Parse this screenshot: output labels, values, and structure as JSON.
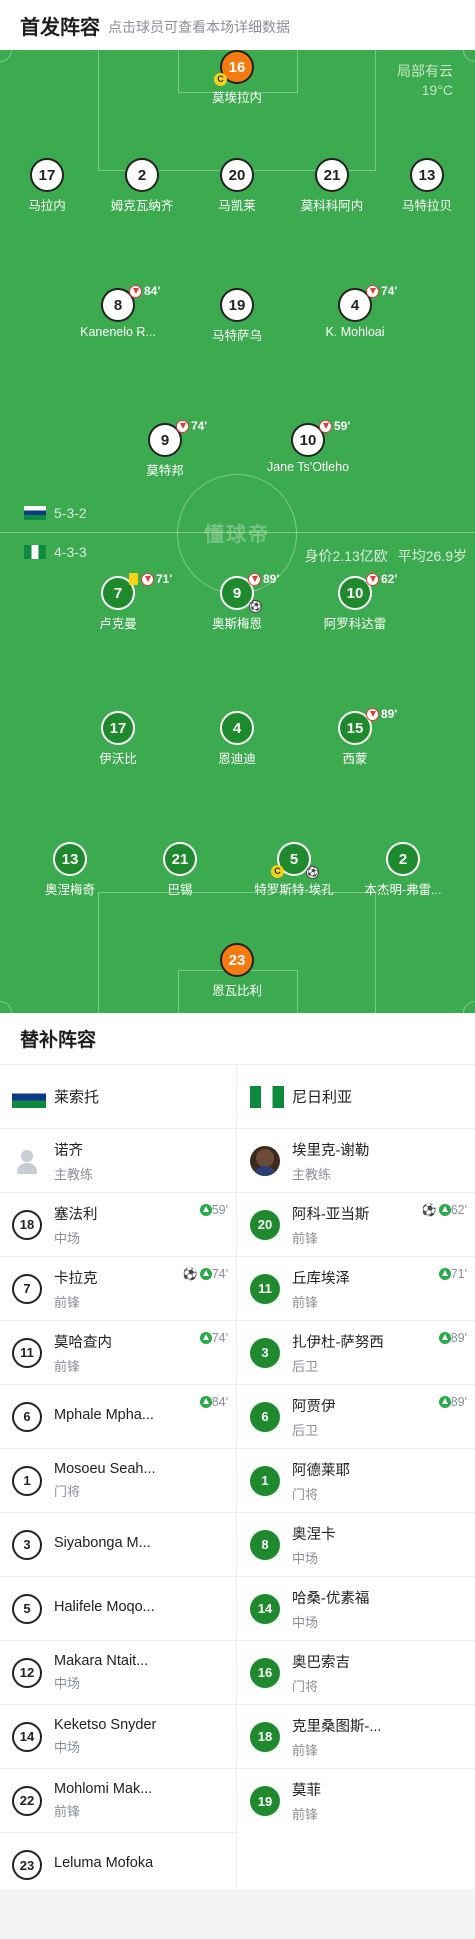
{
  "header": {
    "title": "首发阵容",
    "subtitle": "点击球员可查看本场详细数据"
  },
  "weather": {
    "condition": "局部有云",
    "temp": "19°C"
  },
  "home": {
    "name": "莱索托",
    "formation": "5-3-2",
    "goalkeeper": {
      "num": "16",
      "name": "莫埃拉内",
      "captain": "C"
    },
    "defenders": [
      {
        "num": "17",
        "name": "马拉内"
      },
      {
        "num": "2",
        "name": "姆克瓦纳齐"
      },
      {
        "num": "20",
        "name": "马凯莱"
      },
      {
        "num": "21",
        "name": "莫科科阿内"
      },
      {
        "num": "13",
        "name": "马特拉贝"
      }
    ],
    "midfielders": [
      {
        "num": "8",
        "name": "Kanenelo R...",
        "sub": "84'"
      },
      {
        "num": "19",
        "name": "马特萨乌"
      },
      {
        "num": "4",
        "name": "K. Mohloai",
        "sub": "74'"
      }
    ],
    "forwards": [
      {
        "num": "9",
        "name": "莫特邦",
        "sub": "74'"
      },
      {
        "num": "10",
        "name": "Jane Ts'Otleho",
        "sub": "59'"
      }
    ]
  },
  "away": {
    "name": "尼日利亚",
    "formation": "4-3-3",
    "value_label": "身价2.13亿欧",
    "age_label": "平均26.9岁",
    "forwards": [
      {
        "num": "7",
        "name": "卢克曼",
        "sub": "71'"
      },
      {
        "num": "9",
        "name": "奥斯梅恩",
        "sub": "89'"
      },
      {
        "num": "10",
        "name": "阿罗科达雷",
        "sub": "62'"
      }
    ],
    "midfielders": [
      {
        "num": "17",
        "name": "伊沃比"
      },
      {
        "num": "4",
        "name": "恩迪迪"
      },
      {
        "num": "15",
        "name": "西蒙",
        "sub": "89'"
      }
    ],
    "defenders": [
      {
        "num": "13",
        "name": "奥涅梅奇"
      },
      {
        "num": "21",
        "name": "巴锡"
      },
      {
        "num": "5",
        "name": "特罗斯特-埃孔",
        "captain": "C"
      },
      {
        "num": "2",
        "name": "本杰明-弗雷..."
      }
    ],
    "goalkeeper": {
      "num": "23",
      "name": "恩瓦比利"
    }
  },
  "subs_title": "替补阵容",
  "home_bench": {
    "team": "莱索托",
    "coach": {
      "name": "诺齐",
      "role": "主教练"
    },
    "players": [
      {
        "num": "18",
        "name": "塞法利",
        "pos": "中场",
        "ev": "59'"
      },
      {
        "num": "7",
        "name": "卡拉克",
        "pos": "前锋",
        "ev": "74'",
        "goal": "⚽"
      },
      {
        "num": "11",
        "name": "莫哈查内",
        "pos": "前锋",
        "ev": "74'"
      },
      {
        "num": "6",
        "name": "Mphale Mpha...",
        "pos": "",
        "ev": "84'"
      },
      {
        "num": "1",
        "name": "Mosoeu Seah...",
        "pos": "门将"
      },
      {
        "num": "3",
        "name": "Siyabonga M...",
        "pos": ""
      },
      {
        "num": "5",
        "name": "Halifele Moqo...",
        "pos": ""
      },
      {
        "num": "12",
        "name": "Makara Ntait...",
        "pos": "中场"
      },
      {
        "num": "14",
        "name": "Keketso Snyder",
        "pos": "中场"
      },
      {
        "num": "22",
        "name": "Mohlomi Mak...",
        "pos": "前锋"
      },
      {
        "num": "23",
        "name": "Leluma Mofoka",
        "pos": ""
      }
    ]
  },
  "away_bench": {
    "team": "尼日利亚",
    "coach": {
      "name": "埃里克-谢勒",
      "role": "主教练"
    },
    "players": [
      {
        "num": "20",
        "name": "阿科-亚当斯",
        "pos": "前锋",
        "ev": "62'",
        "goal": "⚽"
      },
      {
        "num": "11",
        "name": "丘库埃泽",
        "pos": "前锋",
        "ev": "71'"
      },
      {
        "num": "3",
        "name": "扎伊杜-萨努西",
        "pos": "后卫",
        "ev": "89'"
      },
      {
        "num": "6",
        "name": "阿贾伊",
        "pos": "后卫",
        "ev": "89'"
      },
      {
        "num": "1",
        "name": "阿德莱耶",
        "pos": "门将"
      },
      {
        "num": "8",
        "name": "奥涅卡",
        "pos": "中场"
      },
      {
        "num": "14",
        "name": "哈桑-优素福",
        "pos": "中场"
      },
      {
        "num": "16",
        "name": "奥巴索吉",
        "pos": "门将"
      },
      {
        "num": "18",
        "name": "克里桑图斯-...",
        "pos": "前锋"
      },
      {
        "num": "19",
        "name": "莫菲",
        "pos": "前锋"
      }
    ]
  }
}
